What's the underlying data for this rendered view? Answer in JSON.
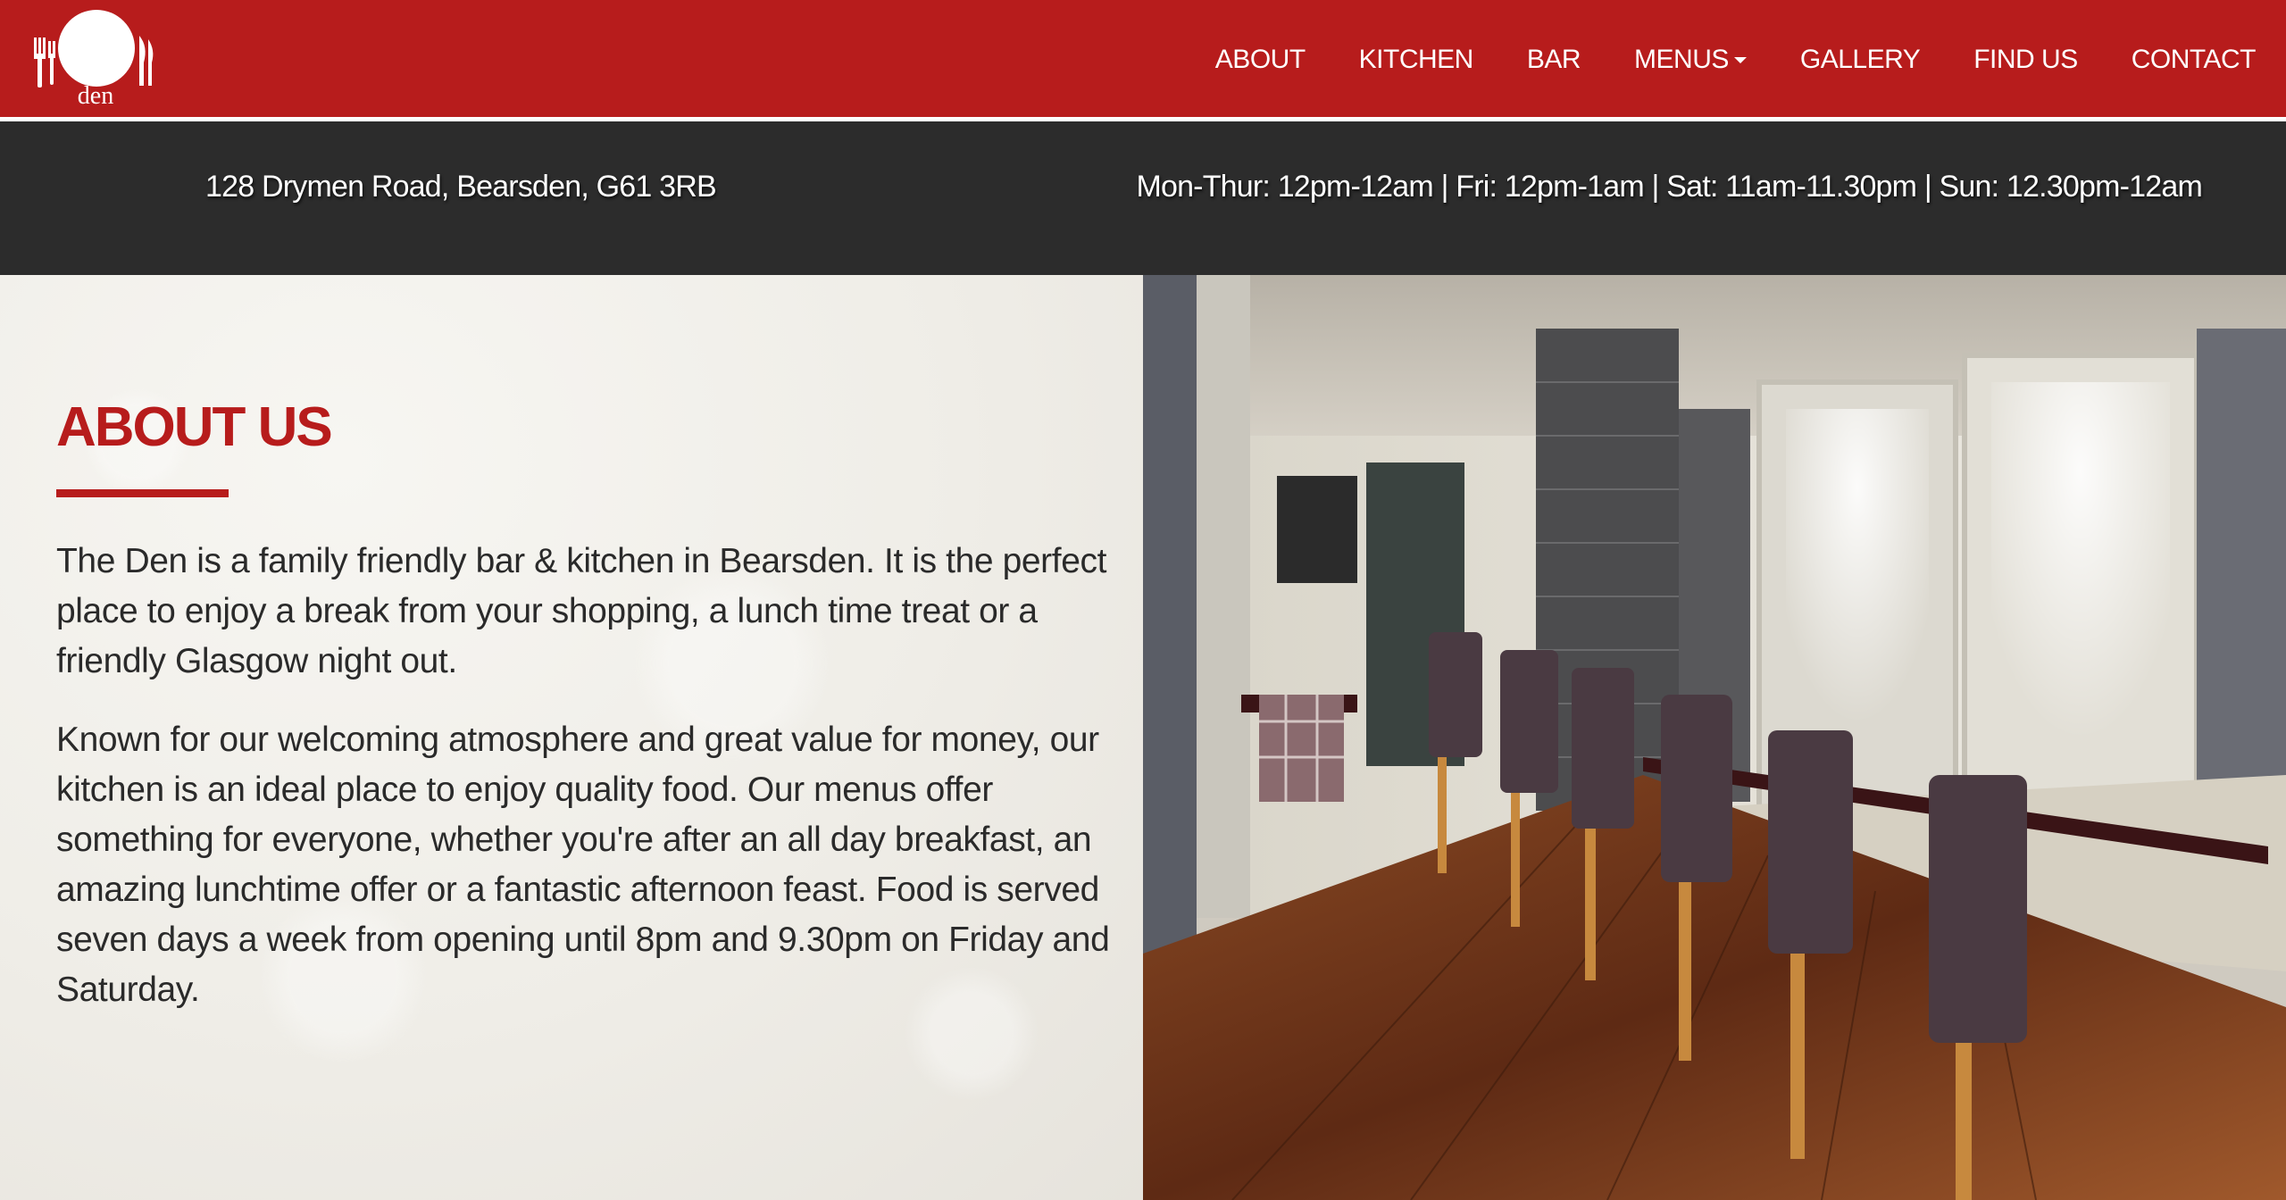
{
  "brand": {
    "name": "den",
    "logo_icon": "plate-fork-knife-icon"
  },
  "nav": {
    "items": [
      {
        "label": "ABOUT"
      },
      {
        "label": "KITCHEN"
      },
      {
        "label": "BAR"
      },
      {
        "label": "MENUS",
        "has_dropdown": true
      },
      {
        "label": "GALLERY"
      },
      {
        "label": "FIND US"
      },
      {
        "label": "CONTACT"
      }
    ]
  },
  "info_bar": {
    "address": "128 Drymen Road, Bearsden, G61 3RB",
    "hours": "Mon-Thur: 12pm-12am | Fri: 12pm-1am | Sat: 11am-11.30pm | Sun: 12.30pm-12am"
  },
  "about": {
    "title": "ABOUT US",
    "paragraphs": [
      "The Den is a family friendly bar & kitchen in Bearsden. It is the perfect place to enjoy a break from your shopping, a lunch time treat or a friendly Glasgow night out.",
      "Known for our welcoming atmosphere and great value for money, our kitchen is an ideal place to enjoy quality food. Our menus offer something for everyone, whether you're after an all day breakfast, an amazing lunchtime offer or a fantastic afternoon feast. Food is served seven days a week from opening until 8pm and 9.30pm on Friday and Saturday."
    ]
  },
  "colors": {
    "brand_red": "#b71c1c",
    "info_bar": "#2c2c2c",
    "text_dark": "#2a2a2a"
  }
}
